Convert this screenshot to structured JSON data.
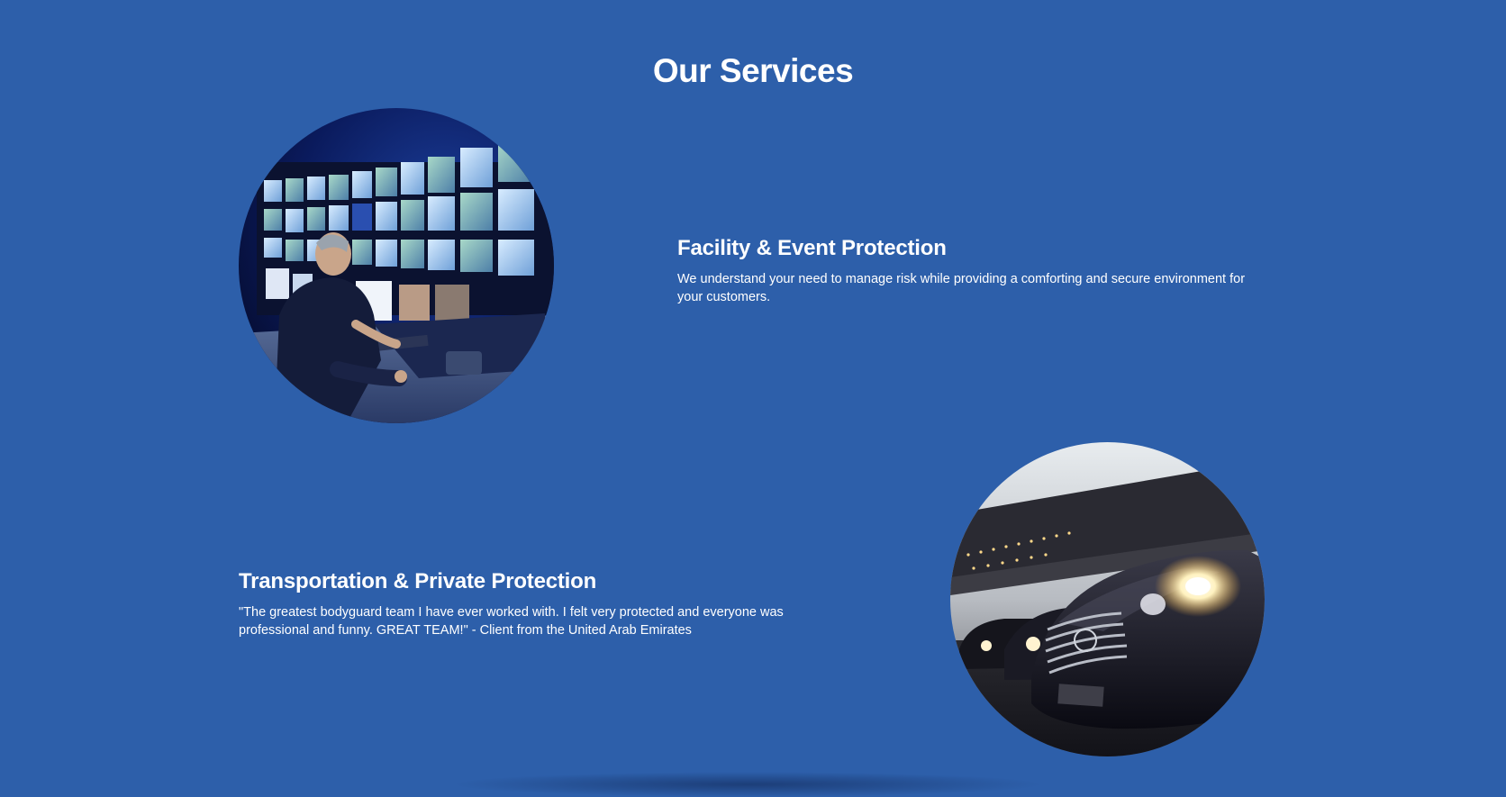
{
  "section": {
    "title": "Our Services"
  },
  "services": [
    {
      "title": "Facility & Event Protection",
      "description": "We understand your need to manage risk while providing a comforting and secure environment for your customers.",
      "image_icon": "surveillance-control-room-photo"
    },
    {
      "title": "Transportation & Private Protection",
      "description": "\"The greatest bodyguard team I have ever worked with. I felt very protected and everyone was professional and funny. GREAT TEAM!\" - Client from the United Arab Emirates",
      "image_icon": "luxury-cars-photo"
    }
  ],
  "colors": {
    "background": "#2d5faa",
    "text": "#ffffff"
  }
}
